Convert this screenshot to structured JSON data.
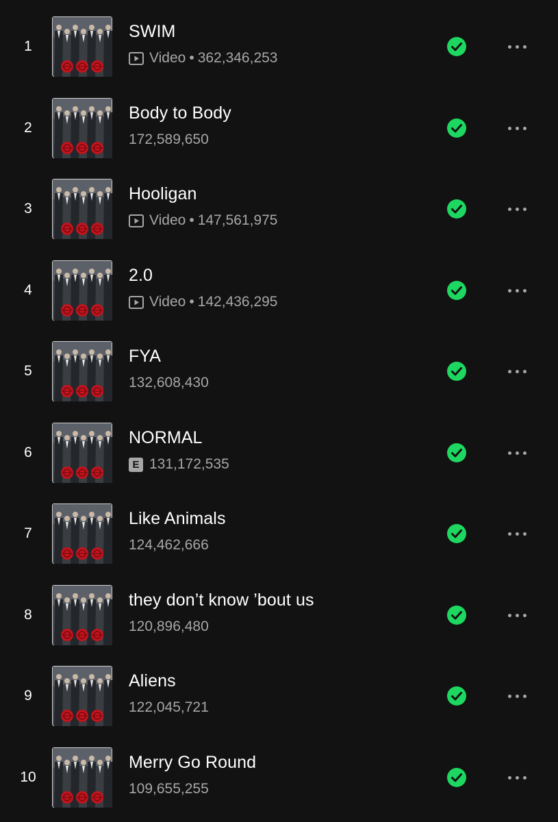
{
  "colors": {
    "background": "#121212",
    "text_primary": "#ffffff",
    "text_secondary": "#a7a7a7",
    "accent_green": "#1ed760"
  },
  "icons": {
    "video": "video-icon",
    "explicit": "explicit-badge",
    "saved": "check-circle-icon",
    "more": "more-options-icon",
    "cover": "album-cover"
  },
  "separator": "•",
  "explicit_label": "E",
  "tracks": [
    {
      "rank": "1",
      "title": "SWIM",
      "video_label": "Video",
      "plays": "362,346,253",
      "explicit": false
    },
    {
      "rank": "2",
      "title": "Body to Body",
      "plays": "172,589,650",
      "explicit": false
    },
    {
      "rank": "3",
      "title": "Hooligan",
      "video_label": "Video",
      "plays": "147,561,975",
      "explicit": false
    },
    {
      "rank": "4",
      "title": "2.0",
      "video_label": "Video",
      "plays": "142,436,295",
      "explicit": false
    },
    {
      "rank": "5",
      "title": "FYA",
      "plays": "132,608,430",
      "explicit": false
    },
    {
      "rank": "6",
      "title": "NORMAL",
      "plays": "131,172,535",
      "explicit": true
    },
    {
      "rank": "7",
      "title": "Like Animals",
      "plays": "124,462,666",
      "explicit": false
    },
    {
      "rank": "8",
      "title": "they don’t know ’bout us",
      "plays": "120,896,480",
      "explicit": false
    },
    {
      "rank": "9",
      "title": "Aliens",
      "plays": "122,045,721",
      "explicit": false
    },
    {
      "rank": "10",
      "title": "Merry Go Round",
      "plays": "109,655,255",
      "explicit": false
    }
  ]
}
